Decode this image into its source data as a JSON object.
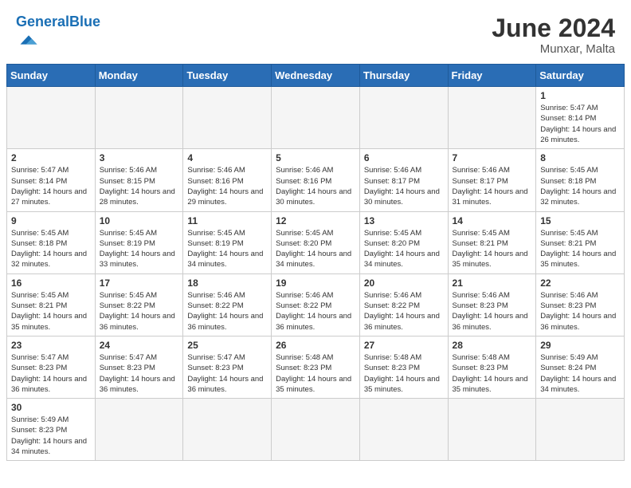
{
  "header": {
    "logo_general": "General",
    "logo_blue": "Blue",
    "month_year": "June 2024",
    "location": "Munxar, Malta"
  },
  "weekdays": [
    "Sunday",
    "Monday",
    "Tuesday",
    "Wednesday",
    "Thursday",
    "Friday",
    "Saturday"
  ],
  "days": [
    {
      "date": "",
      "empty": true
    },
    {
      "date": "",
      "empty": true
    },
    {
      "date": "",
      "empty": true
    },
    {
      "date": "",
      "empty": true
    },
    {
      "date": "",
      "empty": true
    },
    {
      "date": "",
      "empty": true
    },
    {
      "date": "1",
      "sunrise": "Sunrise: 5:47 AM",
      "sunset": "Sunset: 8:14 PM",
      "daylight": "Daylight: 14 hours and 26 minutes."
    },
    {
      "date": "2",
      "sunrise": "Sunrise: 5:47 AM",
      "sunset": "Sunset: 8:14 PM",
      "daylight": "Daylight: 14 hours and 27 minutes."
    },
    {
      "date": "3",
      "sunrise": "Sunrise: 5:46 AM",
      "sunset": "Sunset: 8:15 PM",
      "daylight": "Daylight: 14 hours and 28 minutes."
    },
    {
      "date": "4",
      "sunrise": "Sunrise: 5:46 AM",
      "sunset": "Sunset: 8:16 PM",
      "daylight": "Daylight: 14 hours and 29 minutes."
    },
    {
      "date": "5",
      "sunrise": "Sunrise: 5:46 AM",
      "sunset": "Sunset: 8:16 PM",
      "daylight": "Daylight: 14 hours and 30 minutes."
    },
    {
      "date": "6",
      "sunrise": "Sunrise: 5:46 AM",
      "sunset": "Sunset: 8:17 PM",
      "daylight": "Daylight: 14 hours and 30 minutes."
    },
    {
      "date": "7",
      "sunrise": "Sunrise: 5:46 AM",
      "sunset": "Sunset: 8:17 PM",
      "daylight": "Daylight: 14 hours and 31 minutes."
    },
    {
      "date": "8",
      "sunrise": "Sunrise: 5:45 AM",
      "sunset": "Sunset: 8:18 PM",
      "daylight": "Daylight: 14 hours and 32 minutes."
    },
    {
      "date": "9",
      "sunrise": "Sunrise: 5:45 AM",
      "sunset": "Sunset: 8:18 PM",
      "daylight": "Daylight: 14 hours and 32 minutes."
    },
    {
      "date": "10",
      "sunrise": "Sunrise: 5:45 AM",
      "sunset": "Sunset: 8:19 PM",
      "daylight": "Daylight: 14 hours and 33 minutes."
    },
    {
      "date": "11",
      "sunrise": "Sunrise: 5:45 AM",
      "sunset": "Sunset: 8:19 PM",
      "daylight": "Daylight: 14 hours and 34 minutes."
    },
    {
      "date": "12",
      "sunrise": "Sunrise: 5:45 AM",
      "sunset": "Sunset: 8:20 PM",
      "daylight": "Daylight: 14 hours and 34 minutes."
    },
    {
      "date": "13",
      "sunrise": "Sunrise: 5:45 AM",
      "sunset": "Sunset: 8:20 PM",
      "daylight": "Daylight: 14 hours and 34 minutes."
    },
    {
      "date": "14",
      "sunrise": "Sunrise: 5:45 AM",
      "sunset": "Sunset: 8:21 PM",
      "daylight": "Daylight: 14 hours and 35 minutes."
    },
    {
      "date": "15",
      "sunrise": "Sunrise: 5:45 AM",
      "sunset": "Sunset: 8:21 PM",
      "daylight": "Daylight: 14 hours and 35 minutes."
    },
    {
      "date": "16",
      "sunrise": "Sunrise: 5:45 AM",
      "sunset": "Sunset: 8:21 PM",
      "daylight": "Daylight: 14 hours and 35 minutes."
    },
    {
      "date": "17",
      "sunrise": "Sunrise: 5:45 AM",
      "sunset": "Sunset: 8:22 PM",
      "daylight": "Daylight: 14 hours and 36 minutes."
    },
    {
      "date": "18",
      "sunrise": "Sunrise: 5:46 AM",
      "sunset": "Sunset: 8:22 PM",
      "daylight": "Daylight: 14 hours and 36 minutes."
    },
    {
      "date": "19",
      "sunrise": "Sunrise: 5:46 AM",
      "sunset": "Sunset: 8:22 PM",
      "daylight": "Daylight: 14 hours and 36 minutes."
    },
    {
      "date": "20",
      "sunrise": "Sunrise: 5:46 AM",
      "sunset": "Sunset: 8:22 PM",
      "daylight": "Daylight: 14 hours and 36 minutes."
    },
    {
      "date": "21",
      "sunrise": "Sunrise: 5:46 AM",
      "sunset": "Sunset: 8:23 PM",
      "daylight": "Daylight: 14 hours and 36 minutes."
    },
    {
      "date": "22",
      "sunrise": "Sunrise: 5:46 AM",
      "sunset": "Sunset: 8:23 PM",
      "daylight": "Daylight: 14 hours and 36 minutes."
    },
    {
      "date": "23",
      "sunrise": "Sunrise: 5:47 AM",
      "sunset": "Sunset: 8:23 PM",
      "daylight": "Daylight: 14 hours and 36 minutes."
    },
    {
      "date": "24",
      "sunrise": "Sunrise: 5:47 AM",
      "sunset": "Sunset: 8:23 PM",
      "daylight": "Daylight: 14 hours and 36 minutes."
    },
    {
      "date": "25",
      "sunrise": "Sunrise: 5:47 AM",
      "sunset": "Sunset: 8:23 PM",
      "daylight": "Daylight: 14 hours and 36 minutes."
    },
    {
      "date": "26",
      "sunrise": "Sunrise: 5:48 AM",
      "sunset": "Sunset: 8:23 PM",
      "daylight": "Daylight: 14 hours and 35 minutes."
    },
    {
      "date": "27",
      "sunrise": "Sunrise: 5:48 AM",
      "sunset": "Sunset: 8:23 PM",
      "daylight": "Daylight: 14 hours and 35 minutes."
    },
    {
      "date": "28",
      "sunrise": "Sunrise: 5:48 AM",
      "sunset": "Sunset: 8:23 PM",
      "daylight": "Daylight: 14 hours and 35 minutes."
    },
    {
      "date": "29",
      "sunrise": "Sunrise: 5:49 AM",
      "sunset": "Sunset: 8:24 PM",
      "daylight": "Daylight: 14 hours and 34 minutes."
    },
    {
      "date": "30",
      "sunrise": "Sunrise: 5:49 AM",
      "sunset": "Sunset: 8:23 PM",
      "daylight": "Daylight: 14 hours and 34 minutes."
    },
    {
      "date": "",
      "empty": true
    },
    {
      "date": "",
      "empty": true
    },
    {
      "date": "",
      "empty": true
    },
    {
      "date": "",
      "empty": true
    },
    {
      "date": "",
      "empty": true
    },
    {
      "date": "",
      "empty": true
    }
  ]
}
